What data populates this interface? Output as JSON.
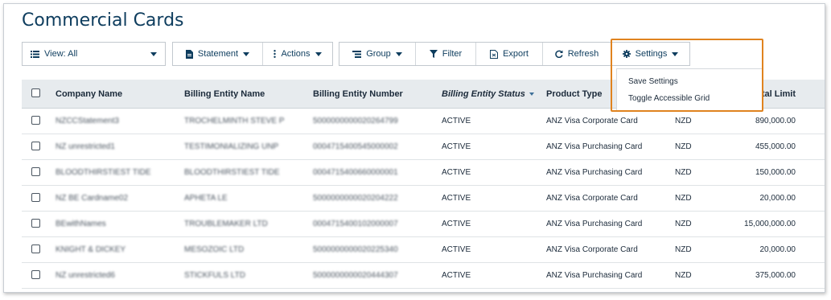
{
  "page": {
    "title": "Commercial Cards"
  },
  "toolbar": {
    "view_label": "View: All",
    "statement_label": "Statement",
    "actions_label": "Actions",
    "group_label": "Group",
    "filter_label": "Filter",
    "export_label": "Export",
    "refresh_label": "Refresh",
    "settings_label": "Settings"
  },
  "settings_menu": {
    "items": [
      "Save Settings",
      "Toggle Accessible Grid"
    ]
  },
  "highlight_color": "#e0831f",
  "grid": {
    "headers": {
      "company": "Company Name",
      "billing_name": "Billing Entity Name",
      "billing_number": "Billing Entity Number",
      "billing_status": "Billing Entity Status",
      "product": "Product Type",
      "limit": "tal Limit"
    },
    "rows": [
      {
        "company": "NZCCStatement3",
        "billing_name": "TROCHELMINTH STEVE P",
        "billing_number": "5000000000020264799",
        "status": "ACTIVE",
        "product": "ANZ Visa Corporate Card",
        "currency": "NZD",
        "limit": "890,000.00"
      },
      {
        "company": "NZ unrestricted1",
        "billing_name": "TESTIMONIALIZING UNP",
        "billing_number": "0004715400545000002",
        "status": "ACTIVE",
        "product": "ANZ Visa Purchasing Card",
        "currency": "NZD",
        "limit": "455,000.00"
      },
      {
        "company": "BLOODTHIRSTIEST TIDE",
        "billing_name": "BLOODTHIRSTIEST TIDE",
        "billing_number": "0004715400660000001",
        "status": "ACTIVE",
        "product": "ANZ Visa Purchasing Card",
        "currency": "NZD",
        "limit": "150,000.00"
      },
      {
        "company": "NZ BE Cardname02",
        "billing_name": "APHETA LE",
        "billing_number": "5000000000020204222",
        "status": "ACTIVE",
        "product": "ANZ Visa Corporate Card",
        "currency": "NZD",
        "limit": "20,000.00"
      },
      {
        "company": "BEwithNames",
        "billing_name": "TROUBLEMAKER LTD",
        "billing_number": "0004715400102000007",
        "status": "ACTIVE",
        "product": "ANZ Visa Purchasing Card",
        "currency": "NZD",
        "limit": "15,000,000.00"
      },
      {
        "company": "KNIGHT & DICKEY",
        "billing_name": "MESOZOIC LTD",
        "billing_number": "5000000000020225340",
        "status": "ACTIVE",
        "product": "ANZ Visa Corporate Card",
        "currency": "NZD",
        "limit": "20,000.00"
      },
      {
        "company": "NZ unrestricted6",
        "billing_name": "STICKFULS LTD",
        "billing_number": "5000000000020444307",
        "status": "ACTIVE",
        "product": "ANZ Visa Purchasing Card",
        "currency": "NZD",
        "limit": "375,000.00"
      }
    ]
  }
}
